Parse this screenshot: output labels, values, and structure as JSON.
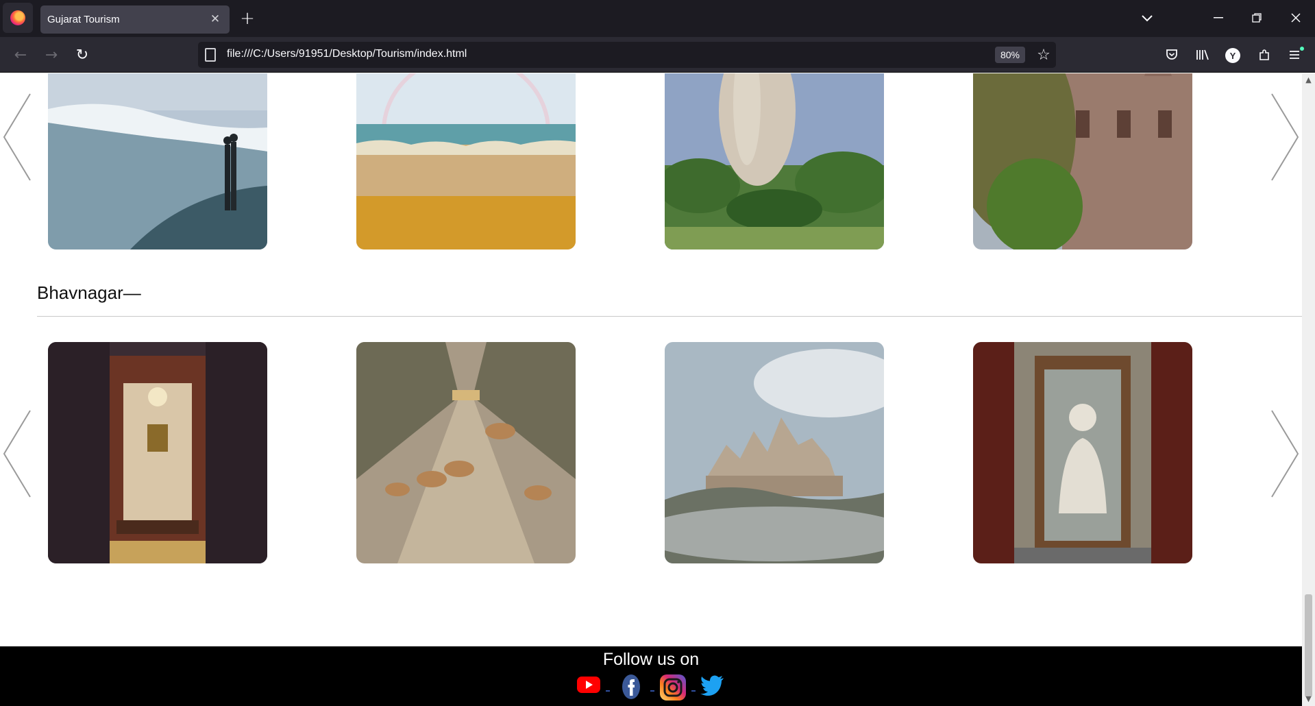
{
  "browser": {
    "tab_title": "Gujarat Tourism",
    "tab_close": "✕",
    "new_tab": "+",
    "list_tabs": "⌄",
    "minimize": "—",
    "restore": "❐",
    "close": "✕",
    "back": "←",
    "forward": "→",
    "reload": "↻",
    "url": "file:///C:/Users/91951/Desktop/Tourism/index.html",
    "zoom": "80%",
    "bookmark": "☆",
    "pocket": "⛉",
    "library": "|||\\",
    "account_initial": "Y",
    "extensions": "⧉",
    "menu": "≡"
  },
  "page": {
    "section_heading": "Bhavnagar—",
    "top_row_icons": [
      "beach-couple-image",
      "rainbow-sea-image",
      "hot-air-balloon-park-image",
      "palace-architecture-image"
    ],
    "bhavnagar_row_icons": [
      "palace-interior-image",
      "blackbuck-deer-image",
      "palitana-temples-image",
      "gandhi-statue-image"
    ],
    "prev_icon": "chevron-left-icon",
    "next_icon": "chevron-right-icon"
  },
  "footer": {
    "follow_text": "Follow us on",
    "social": [
      {
        "name": "youtube-icon",
        "color": "#ff0000"
      },
      {
        "name": "facebook-icon",
        "color": "#3b5998"
      },
      {
        "name": "instagram-icon",
        "color": "#c13584"
      },
      {
        "name": "twitter-icon",
        "color": "#1da1f2"
      }
    ]
  }
}
